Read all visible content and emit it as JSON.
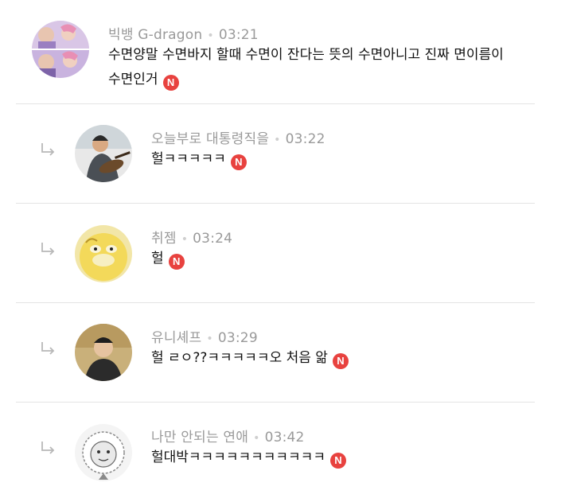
{
  "comments": [
    {
      "author": "빅뱅 G-dragon",
      "separator": "•",
      "time": "03:21",
      "text_line1": "수면양말 수면바지 할때 수면이 잔다는 뜻의 수면아니고 진짜 면이름이",
      "text_line2": "수면인거",
      "badge": "N",
      "is_reply": false
    },
    {
      "author": "오늘부로 대통령직을",
      "separator": "•",
      "time": "03:22",
      "text": "헐ㅋㅋㅋㅋㅋ",
      "badge": "N",
      "is_reply": true
    },
    {
      "author": "취젬",
      "separator": "•",
      "time": "03:24",
      "text": "헐",
      "badge": "N",
      "is_reply": true
    },
    {
      "author": "유니셰프",
      "separator": "•",
      "time": "03:29",
      "text": "헐 ㄹㅇ??ㅋㅋㅋㅋㅋ오 처음 앎",
      "badge": "N",
      "is_reply": true
    },
    {
      "author": "나만 안되는 연애",
      "separator": "•",
      "time": "03:42",
      "text": "헐대박ㅋㅋㅋㅋㅋㅋㅋㅋㅋㅋㅋ",
      "badge": "N",
      "is_reply": true
    }
  ],
  "colors": {
    "badge": "#e8423f",
    "meta": "#9a9a9a",
    "divider": "#e4e4e4"
  },
  "icons": {
    "reply": "reply-arrow-icon",
    "new": "new-badge"
  }
}
